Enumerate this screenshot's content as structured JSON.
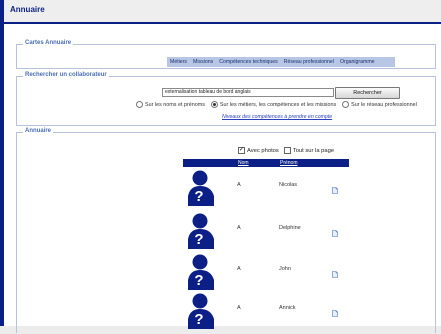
{
  "header": {
    "title": "Annuaire"
  },
  "cartes": {
    "legend": "Cartes Annuaire",
    "tabs": [
      "Métiers",
      "Missions",
      "Compétences techniques",
      "Réseau professionnel",
      "Organigramme"
    ]
  },
  "search": {
    "legend": "Rechercher un collaborateur",
    "value": "externalisation tableau de bord anglais",
    "button_label": "Rechercher",
    "options": [
      {
        "label": "Sur les noms et prénoms",
        "selected": false
      },
      {
        "label": "Sur les métiers, les compétences et les missions",
        "selected": true
      },
      {
        "label": "Sur le réseau professionnel",
        "selected": false
      }
    ],
    "link_label": "Niveaux des compétences à prendre en compte"
  },
  "annuaire": {
    "legend": "Annuaire",
    "with_photos_label": "Avec photos",
    "with_photos_checked": true,
    "all_on_page_label": "Tout sur la page",
    "all_on_page_checked": false,
    "columns": {
      "nom": "Nom",
      "prenom": "Prénom"
    },
    "rows": [
      {
        "nom": "A",
        "prenom": "Nicolas"
      },
      {
        "nom": "A",
        "prenom": "Delphine"
      },
      {
        "nom": "A",
        "prenom": "John"
      },
      {
        "nom": "A",
        "prenom": "Annick"
      }
    ]
  },
  "colors": {
    "brand": "#0b1f86",
    "tab_bg": "#b6c6e4",
    "border": "#b7c3dd"
  },
  "icons": {
    "avatar": "unknown-person-icon",
    "doc": "document-icon"
  }
}
